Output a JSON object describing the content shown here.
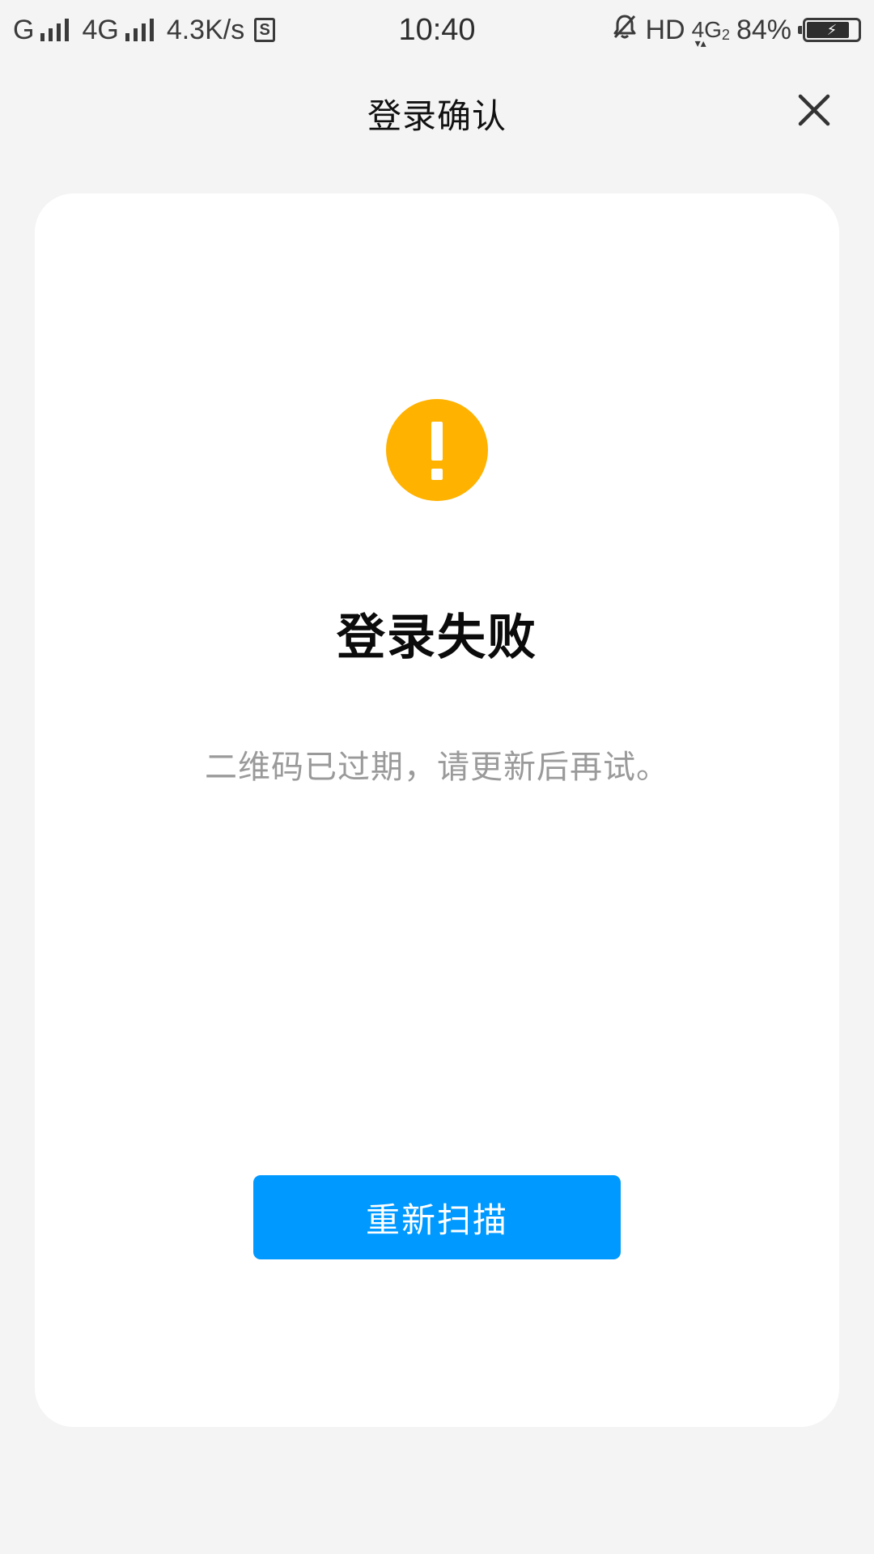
{
  "status_bar": {
    "carrier_1": "G",
    "carrier_2": "4G",
    "net_speed": "4.3K/s",
    "sim_icon": "S",
    "time": "10:40",
    "hd": "HD",
    "network_type": "4G",
    "network_sub": "2",
    "battery_percent": "84%",
    "battery_level": 0.84,
    "icons": [
      "signal-icon",
      "sim-icon",
      "mute-bell-icon",
      "battery-charging-icon"
    ]
  },
  "header": {
    "title": "登录确认",
    "close_icon": "close-icon"
  },
  "result": {
    "icon": "exclamation-icon",
    "icon_color": "#ffb200",
    "title": "登录失败",
    "message": "二维码已过期，请更新后再试。"
  },
  "actions": {
    "rescan_label": "重新扫描",
    "rescan_color": "#0099ff"
  }
}
